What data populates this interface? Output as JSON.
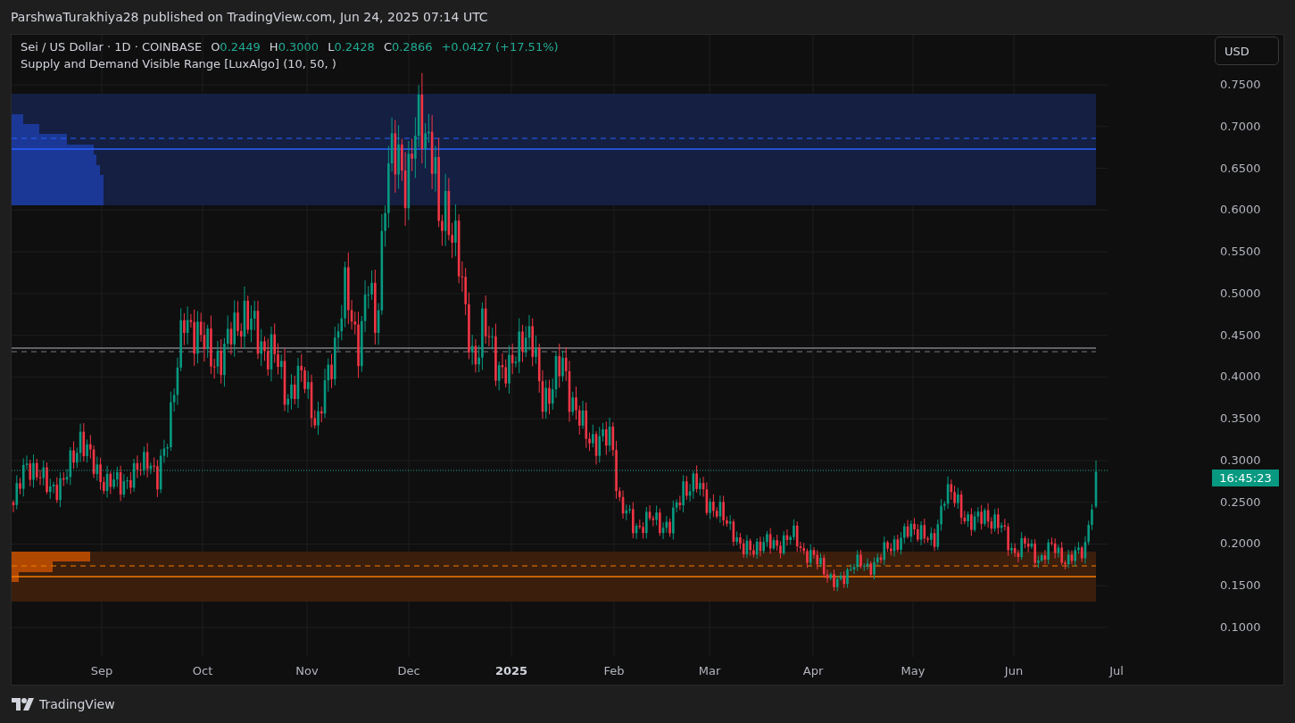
{
  "header": {
    "publication": "ParshwaTurakhiya28 published on TradingView.com, Jun 24, 2025 07:14 UTC"
  },
  "chart": {
    "legend": {
      "symbol": "Sei / US Dollar · 1D · COINBASE",
      "rising": true,
      "ohlc": [
        {
          "label": "O",
          "value": "0.2449"
        },
        {
          "label": "H",
          "value": "0.3000"
        },
        {
          "label": "L",
          "value": "0.2428"
        },
        {
          "label": "C",
          "value": "0.2866"
        }
      ],
      "change": "+0.0427 (+17.51%)"
    },
    "indicator": "Supply and Demand Visible Range [LuxAlgo] (10, 50, )",
    "currency_button": "USD",
    "price_axis": [
      "0.7500",
      "0.7000",
      "0.6500",
      "0.6000",
      "0.5500",
      "0.5000",
      "0.4500",
      "0.4000",
      "0.3500",
      "0.3000",
      "0.2500",
      "0.2000",
      "0.1500",
      "0.1000"
    ],
    "time_axis": [
      {
        "label": "Sep",
        "kind": "month"
      },
      {
        "label": "Oct",
        "kind": "month"
      },
      {
        "label": "Nov",
        "kind": "month"
      },
      {
        "label": "Dec",
        "kind": "month"
      },
      {
        "label": "2025",
        "kind": "year"
      },
      {
        "label": "Feb",
        "kind": "month"
      },
      {
        "label": "Mar",
        "kind": "month"
      },
      {
        "label": "Apr",
        "kind": "month"
      },
      {
        "label": "May",
        "kind": "month"
      },
      {
        "label": "Jun",
        "kind": "month"
      },
      {
        "label": "Jul",
        "kind": "month"
      }
    ],
    "countdown": "16:45:23"
  },
  "footer": {
    "brand": "TradingView"
  }
}
